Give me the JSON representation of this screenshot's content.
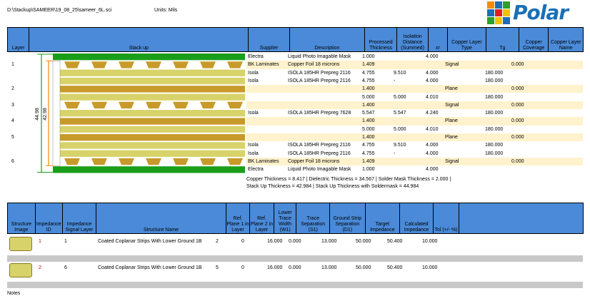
{
  "header": {
    "file_path": "D:\\Stackup\\SAMEER\\19_08_25\\sameer_6L.sci",
    "units": "Units: Mils"
  },
  "logo": {
    "word": "Polar"
  },
  "stack_table": {
    "columns": [
      "Layer",
      "Stack up",
      "Supplier",
      "Description",
      "Processed Thickness",
      "Isolation Distance (Summed)",
      "εr",
      "Copper Layer Type",
      "Tg",
      "Copper Coverage",
      "Copper Layer Name"
    ],
    "rows": [
      {
        "layer": "",
        "supplier": "Electra",
        "description": "Liquid Photo Imagable Mask",
        "thickness": "1.000",
        "isolation": "",
        "er": "4.000",
        "type": "",
        "tg": "",
        "coverage": "",
        "name": "",
        "copper": false
      },
      {
        "layer": "1",
        "supplier": "BK Laminates",
        "description": "Copper Foil 18 microns",
        "thickness": "1.409",
        "isolation": "",
        "er": "",
        "type": "Signal",
        "tg": "",
        "coverage": "0.000",
        "name": "",
        "copper": true
      },
      {
        "layer": "",
        "supplier": "Isola",
        "description": "ISOLA 185HR Prepreg 2116",
        "thickness": "4.755",
        "isolation": "9.510",
        "er": "4.000",
        "type": "",
        "tg": "180.000",
        "coverage": "",
        "name": "",
        "copper": false
      },
      {
        "layer": "",
        "supplier": "Isola",
        "description": "ISOLA 185HR Prepreg 2116",
        "thickness": "4.755",
        "isolation": "-",
        "er": "4.000",
        "type": "",
        "tg": "180.000",
        "coverage": "",
        "name": "",
        "copper": false
      },
      {
        "layer": "2",
        "supplier": "",
        "description": "",
        "thickness": "1.400",
        "isolation": "",
        "er": "",
        "type": "Plane",
        "tg": "",
        "coverage": "0.000",
        "name": "",
        "copper": true
      },
      {
        "layer": "",
        "supplier": "",
        "description": "",
        "thickness": "5.000",
        "isolation": "5.000",
        "er": "4.010",
        "type": "",
        "tg": "180.000",
        "coverage": "",
        "name": "",
        "copper": false
      },
      {
        "layer": "3",
        "supplier": "",
        "description": "",
        "thickness": "1.400",
        "isolation": "",
        "er": "",
        "type": "Signal",
        "tg": "",
        "coverage": "0.000",
        "name": "",
        "copper": true
      },
      {
        "layer": "",
        "supplier": "Isola",
        "description": "ISOLA 185HR Prepreg 7628",
        "thickness": "5.547",
        "isolation": "5.547",
        "er": "4.240",
        "type": "",
        "tg": "180.000",
        "coverage": "",
        "name": "",
        "copper": false
      },
      {
        "layer": "4",
        "supplier": "",
        "description": "",
        "thickness": "1.400",
        "isolation": "",
        "er": "",
        "type": "Plane",
        "tg": "",
        "coverage": "0.000",
        "name": "",
        "copper": true
      },
      {
        "layer": "",
        "supplier": "",
        "description": "",
        "thickness": "5.000",
        "isolation": "5.000",
        "er": "4.010",
        "type": "",
        "tg": "180.000",
        "coverage": "",
        "name": "",
        "copper": false
      },
      {
        "layer": "5",
        "supplier": "",
        "description": "",
        "thickness": "1.400",
        "isolation": "",
        "er": "",
        "type": "Plane",
        "tg": "",
        "coverage": "0.000",
        "name": "",
        "copper": true
      },
      {
        "layer": "",
        "supplier": "Isola",
        "description": "ISOLA 185HR Prepreg 2116",
        "thickness": "4.755",
        "isolation": "9.510",
        "er": "4.000",
        "type": "",
        "tg": "180.000",
        "coverage": "",
        "name": "",
        "copper": false
      },
      {
        "layer": "",
        "supplier": "Isola",
        "description": "ISOLA 185HR Prepreg 2116",
        "thickness": "4.755",
        "isolation": "-",
        "er": "4.000",
        "type": "",
        "tg": "180.000",
        "coverage": "",
        "name": "",
        "copper": false
      },
      {
        "layer": "6",
        "supplier": "BK Laminates",
        "description": "Copper Foil 18 microns",
        "thickness": "1.409",
        "isolation": "",
        "er": "",
        "type": "Signal",
        "tg": "",
        "coverage": "0.000",
        "name": "",
        "copper": true
      },
      {
        "layer": "",
        "supplier": "Electra",
        "description": "Liquid Photo Imagable Mask",
        "thickness": "1.000",
        "isolation": "",
        "er": "4.000",
        "type": "",
        "tg": "",
        "coverage": "",
        "name": "",
        "copper": false
      }
    ],
    "dims": {
      "outer": "44.98",
      "inner": "42.98"
    }
  },
  "summary": {
    "line1": "Copper Thickness = 8.417  | Dielectric Thickness = 34.567  | Solder Mask Thickness = 2.000  |",
    "line2": "Stack Up Thickness = 42.984  | Stack Up Thickness with Soldermask = 44.984"
  },
  "impedance_table": {
    "columns": [
      "Structure Image",
      "Impedance ID",
      "Impedance Signal Layer",
      "Structure Name",
      "Ref. Plane 1 in Layer",
      "Ref. Plane 2 in Layer",
      "Lower Trace Width (W1)",
      "Trace Separation (S1)",
      "Ground Strip Separation (D1)",
      "Target Impedance",
      "Calculated Impedance",
      "Tol (+/- %)"
    ],
    "rows": [
      {
        "id": "1",
        "signal_layer": "1",
        "name": "Coated Coplanar Strips With Lower Ground 1B",
        "ref1": "2",
        "ref2": "0",
        "w1": "16.000",
        "s1": "0.000",
        "d1": "13.000",
        "target": "50.000",
        "calc": "50.400",
        "tol": "10.000"
      },
      {
        "id": "2",
        "signal_layer": "6",
        "name": "Coated Coplanar Strips With Lower Ground 1B",
        "ref1": "5",
        "ref2": "0",
        "w1": "16.000",
        "s1": "0.000",
        "d1": "13.000",
        "target": "50.000",
        "calc": "50.400",
        "tol": "10.000"
      }
    ]
  },
  "notes_label": "Notes",
  "colors": {
    "header": "#4a8ad8",
    "copper_row": "#fff2cc",
    "mask": "#1a9e1a",
    "dielectric": "#d7d36a",
    "plane": "#c89a2a",
    "dim_outer": "#1a9e1a",
    "dim_inner": "#f08a00"
  }
}
